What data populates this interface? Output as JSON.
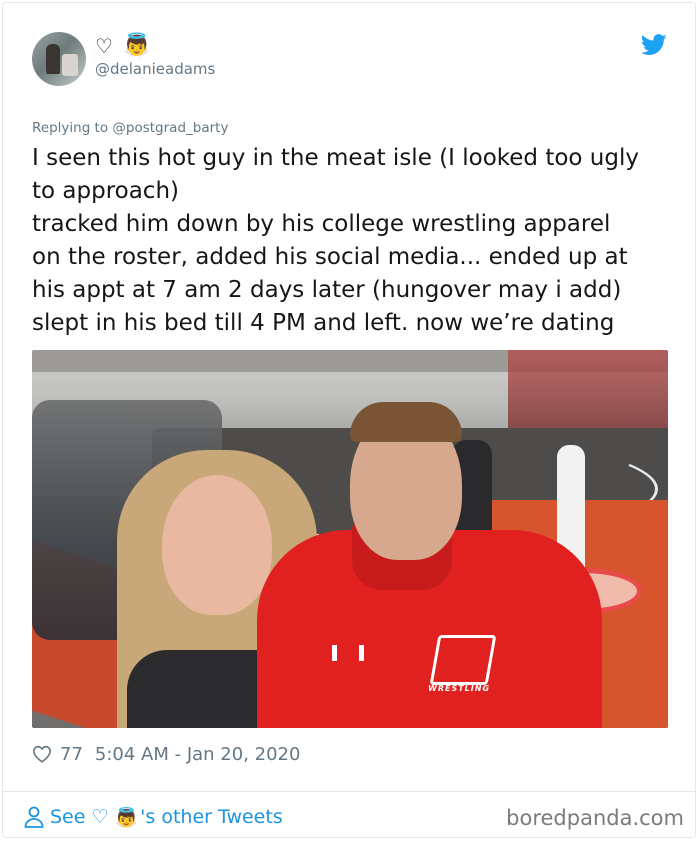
{
  "tweet": {
    "display_name_symbols": [
      "♡",
      "👼"
    ],
    "handle": "@delanieadams",
    "reply_to": "Replying to @postgrad_barty",
    "text_lines": [
      "I seen this hot guy in the meat isle (I looked too ugly",
      "to approach)",
      "tracked him down by his college wrestling apparel",
      "on the roster, added his social media... ended up at",
      "his appt at 7 am 2 days later (hungover may i add)",
      "slept in his bed till 4 PM and left. now we’re dating"
    ],
    "likes": "77",
    "timestamp": "5:04 AM - Jan 20, 2020",
    "photo": {
      "jacket_text": "WRESTLING"
    }
  },
  "footer": {
    "see_label": "See",
    "see_symbols": [
      "♡",
      "👼"
    ],
    "other_tweets": "'s other Tweets"
  },
  "watermark": "boredpanda.com",
  "colors": {
    "twitter_blue": "#1da1f2",
    "link_blue": "#1b95e0",
    "muted_gray": "#657786",
    "border": "#e1e8ed"
  },
  "icons": {
    "brand": "twitter-bird-icon",
    "like": "heart-outline-icon",
    "profile": "user-icon"
  }
}
